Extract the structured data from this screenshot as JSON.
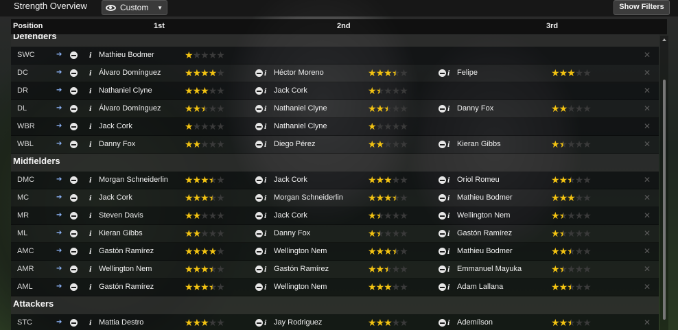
{
  "header": {
    "title": "Strength Overview",
    "view_label": "Custom",
    "filters_label": "Show Filters"
  },
  "columns": {
    "position": "Position",
    "first": "1st",
    "second": "2nd",
    "third": "3rd"
  },
  "groups": [
    {
      "name": "Defenders",
      "rows": [
        {
          "pos": "SWC",
          "p1": {
            "name": "Mathieu Bodmer",
            "rating": 1
          }
        },
        {
          "pos": "DC",
          "p1": {
            "name": "Álvaro Domínguez",
            "rating": 4
          },
          "p2": {
            "name": "Héctor Moreno",
            "rating": 3.5
          },
          "p3": {
            "name": "Felipe",
            "rating": 3
          }
        },
        {
          "pos": "DR",
          "p1": {
            "name": "Nathaniel Clyne",
            "rating": 3
          },
          "p2": {
            "name": "Jack Cork",
            "rating": 1.5
          }
        },
        {
          "pos": "DL",
          "p1": {
            "name": "Álvaro Domínguez",
            "rating": 2.5
          },
          "p2": {
            "name": "Nathaniel Clyne",
            "rating": 2.5
          },
          "p3": {
            "name": "Danny Fox",
            "rating": 2
          }
        },
        {
          "pos": "WBR",
          "p1": {
            "name": "Jack Cork",
            "rating": 1
          },
          "p2": {
            "name": "Nathaniel Clyne",
            "rating": 1
          }
        },
        {
          "pos": "WBL",
          "p1": {
            "name": "Danny Fox",
            "rating": 2
          },
          "p2": {
            "name": "Diego Pérez",
            "rating": 2
          },
          "p3": {
            "name": "Kieran Gibbs",
            "rating": 1.5
          }
        }
      ]
    },
    {
      "name": "Midfielders",
      "rows": [
        {
          "pos": "DMC",
          "p1": {
            "name": "Morgan Schneiderlin",
            "rating": 3.5
          },
          "p2": {
            "name": "Jack Cork",
            "rating": 3
          },
          "p3": {
            "name": "Oriol Romeu",
            "rating": 2.5
          }
        },
        {
          "pos": "MC",
          "p1": {
            "name": "Jack Cork",
            "rating": 3.5
          },
          "p2": {
            "name": "Morgan Schneiderlin",
            "rating": 3.5
          },
          "p3": {
            "name": "Mathieu Bodmer",
            "rating": 3
          }
        },
        {
          "pos": "MR",
          "p1": {
            "name": "Steven Davis",
            "rating": 2
          },
          "p2": {
            "name": "Jack Cork",
            "rating": 1.5
          },
          "p3": {
            "name": "Wellington Nem",
            "rating": 1.5
          }
        },
        {
          "pos": "ML",
          "p1": {
            "name": "Kieran Gibbs",
            "rating": 2
          },
          "p2": {
            "name": "Danny Fox",
            "rating": 1.5
          },
          "p3": {
            "name": "Gastón Ramírez",
            "rating": 1.5
          }
        },
        {
          "pos": "AMC",
          "p1": {
            "name": "Gastón Ramírez",
            "rating": 4
          },
          "p2": {
            "name": "Wellington Nem",
            "rating": 3.5
          },
          "p3": {
            "name": "Mathieu Bodmer",
            "rating": 2.5
          }
        },
        {
          "pos": "AMR",
          "p1": {
            "name": "Wellington Nem",
            "rating": 3.5
          },
          "p2": {
            "name": "Gastón Ramírez",
            "rating": 2.5
          },
          "p3": {
            "name": "Emmanuel Mayuka",
            "rating": 1.5
          }
        },
        {
          "pos": "AML",
          "p1": {
            "name": "Gastón Ramírez",
            "rating": 3.5
          },
          "p2": {
            "name": "Wellington Nem",
            "rating": 3
          },
          "p3": {
            "name": "Adam Lallana",
            "rating": 2.5
          }
        }
      ]
    },
    {
      "name": "Attackers",
      "rows": [
        {
          "pos": "STC",
          "p1": {
            "name": "Mattia Destro",
            "rating": 3
          },
          "p2": {
            "name": "Jay Rodriguez",
            "rating": 3
          },
          "p3": {
            "name": "Ademílson",
            "rating": 2.5
          }
        }
      ]
    }
  ],
  "icons": {
    "go": "go-to-arrow-icon",
    "remove": "remove-icon",
    "info": "info-icon",
    "clear": "clear-icon"
  },
  "colors": {
    "star": "#f3c312",
    "empty_star": "#3a3a3a"
  }
}
